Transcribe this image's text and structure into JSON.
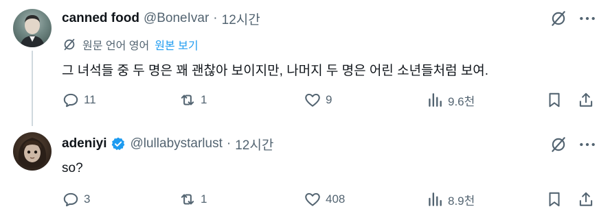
{
  "tweets": [
    {
      "author_name": "canned food",
      "handle": "@BoneIvar",
      "separator": "·",
      "time": "12시간",
      "verified": false,
      "translation": {
        "label": "원문 언어 영어",
        "link": "원본 보기"
      },
      "text": "그 녀석들 중 두 명은 꽤 괜찮아 보이지만, 나머지 두 명은 어린 소년들처럼 보여.",
      "counts": {
        "replies": "11",
        "reposts": "1",
        "likes": "9",
        "views": "9.6천"
      }
    },
    {
      "author_name": "adeniyi",
      "handle": "@lullabystarlust",
      "separator": "·",
      "time": "12시간",
      "verified": true,
      "text": "so?",
      "counts": {
        "replies": "3",
        "reposts": "1",
        "likes": "408",
        "views": "8.9천"
      }
    }
  ],
  "icons": {
    "reply": "reply-icon",
    "repost": "repost-icon",
    "like": "like-icon",
    "views": "views-icon",
    "bookmark": "bookmark-icon",
    "share": "share-icon",
    "grok": "grok-icon",
    "more": "more-icon",
    "translate": "translate-icon",
    "verified": "verified-badge-icon"
  },
  "colors": {
    "text": "#0f1419",
    "secondary": "#536471",
    "link": "#1d9bf0",
    "thread_line": "#cfd9de"
  }
}
